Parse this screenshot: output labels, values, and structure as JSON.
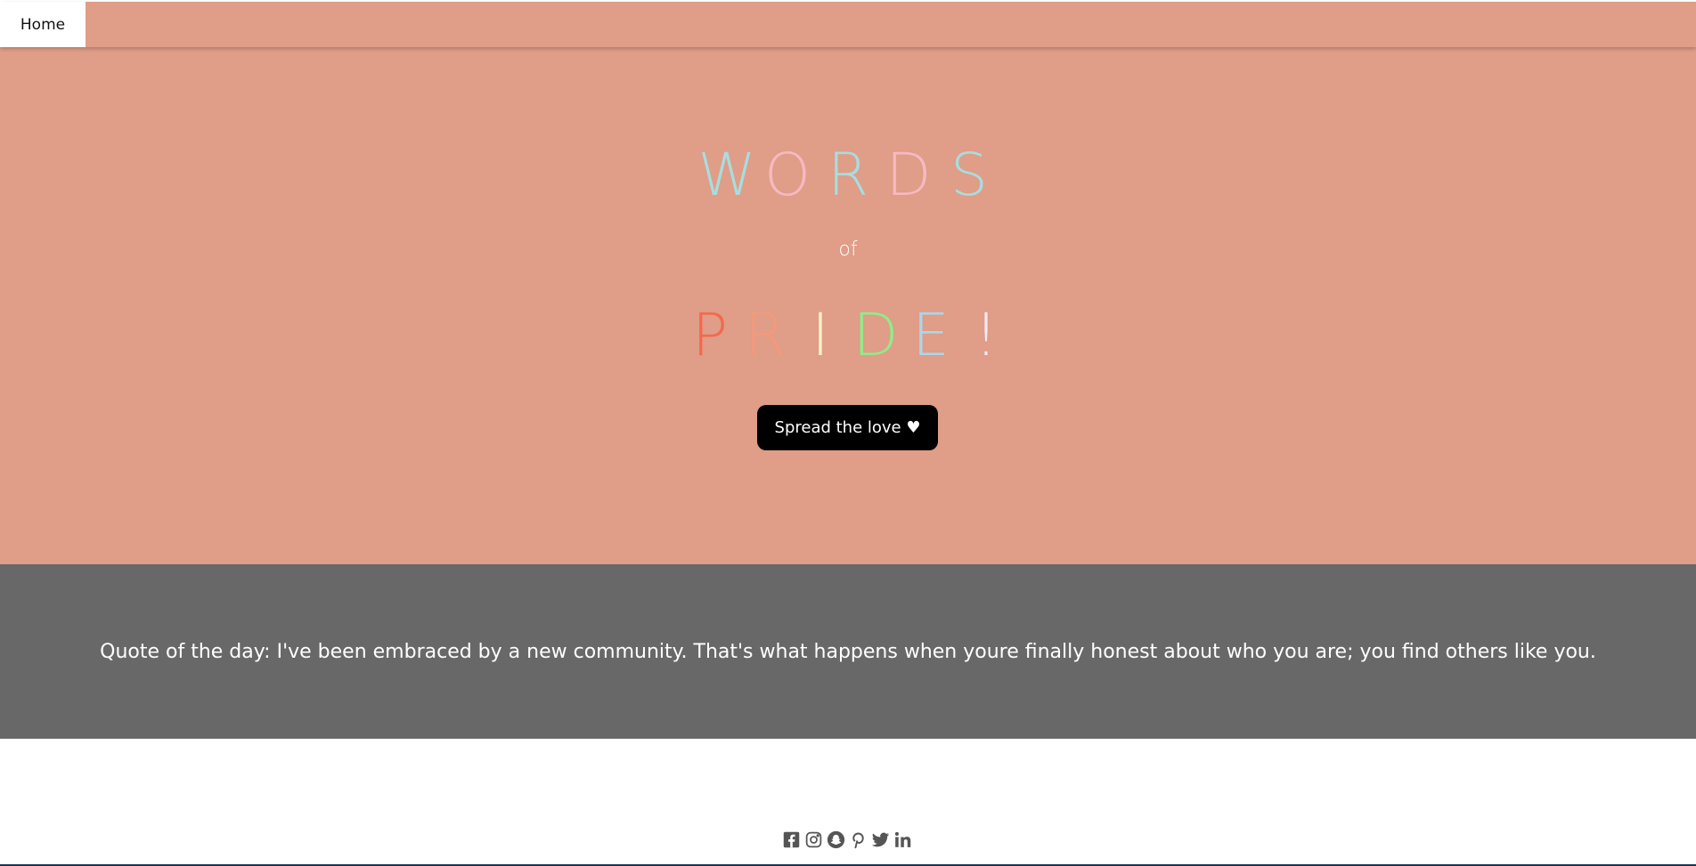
{
  "nav": {
    "home_label": "Home"
  },
  "hero": {
    "words_letters": [
      {
        "char": "W",
        "color": "#a8dde0"
      },
      {
        "char": "O",
        "color": "#f6b9c3"
      },
      {
        "char": "R",
        "color": "#a8dde0"
      },
      {
        "char": "D",
        "color": "#f6b9c3"
      },
      {
        "char": "S",
        "color": "#a8dde0"
      }
    ],
    "of_text": "of",
    "pride_letters": [
      {
        "char": "P",
        "color": "#f2694f"
      },
      {
        "char": "R",
        "color": "#f29a7b"
      },
      {
        "char": "I",
        "color": "#fbf2c8"
      },
      {
        "char": "D",
        "color": "#90ec8a"
      },
      {
        "char": "E",
        "color": "#a9d6ec"
      },
      {
        "char": "!",
        "color": "#f3eaf3"
      }
    ],
    "cta_label": "Spread the love ♥"
  },
  "quote": {
    "text": "Quote of the day: I've been embraced by a new community. That's what happens when youre finally honest about who you are; you find others like you."
  },
  "footer": {
    "social_icons": [
      "facebook-icon",
      "instagram-icon",
      "snapchat-icon",
      "pinterest-icon",
      "twitter-icon",
      "linkedin-icon"
    ]
  },
  "colors": {
    "hero_bg": "#e09d87",
    "quote_bg": "#686868",
    "button_bg": "#000000",
    "icon_color": "#555555"
  }
}
